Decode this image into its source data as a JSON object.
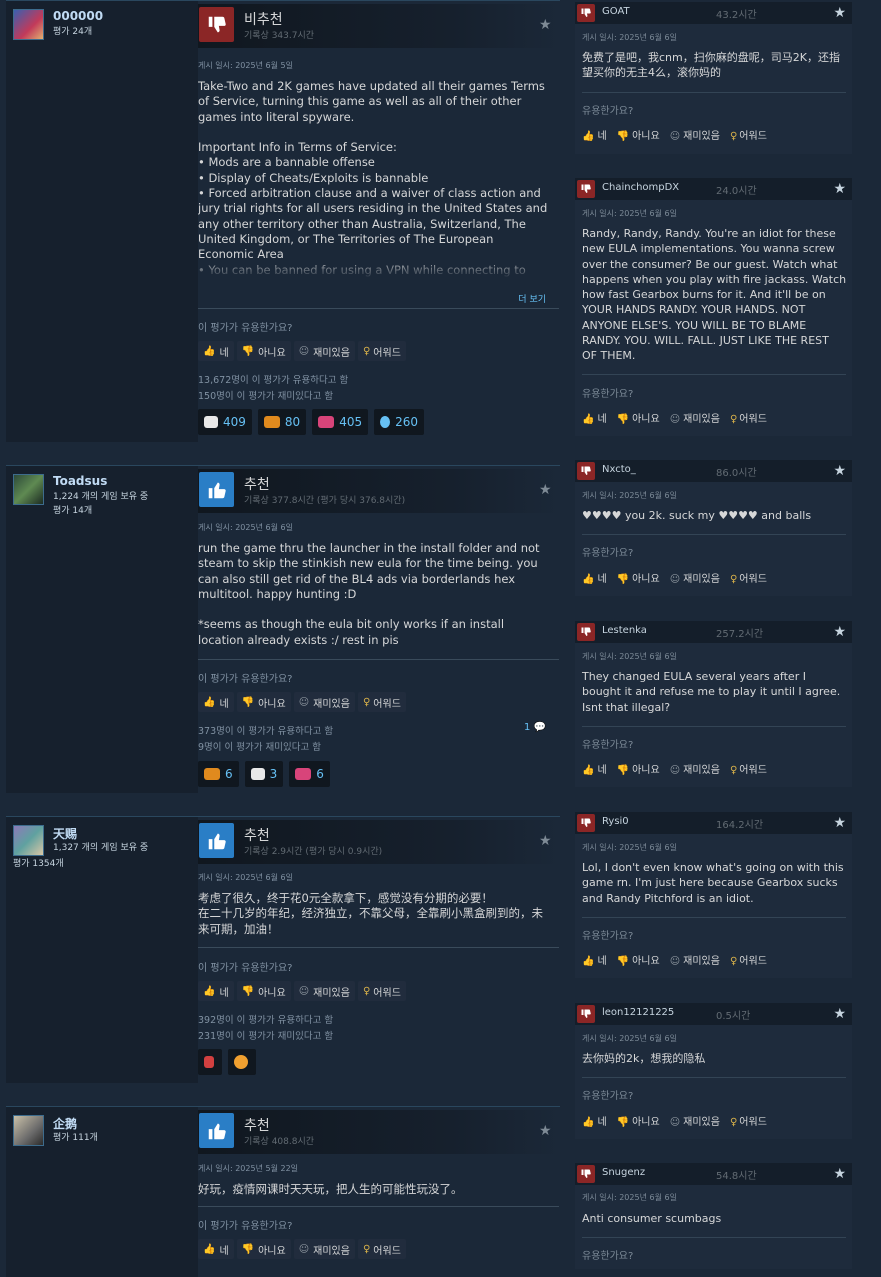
{
  "ui": {
    "helpful_q": "이 평가가 유용한가요?",
    "side_helpful_q": "유용한가요?",
    "btn_yes": "네",
    "btn_no": "아니요",
    "btn_funny": "재미있음",
    "btn_award": "어워드",
    "read_more": "더 보기"
  },
  "reviews": [
    {
      "username": "000000",
      "info": "평가 24개",
      "vote": "비추천",
      "hours": "기록상 343.7시간",
      "posted": "게시 일시: 2025년 6월 5일",
      "text": "Take-Two and 2K games have updated all their games Terms of Service, turning this game as well as all of their other games into literal spyware.\n\nImportant Info in Terms of Service:\n• Mods are a bannable offense\n• Display of Cheats/Exploits is bannable\n• Forced arbitration clause and a waiver of class action and jury trial rights for all users residing in the United States and any other territory other than Australia, Switzerland, The United Kingdom, or The Territories of The European Economic Area\n• You can be banned for using a VPN while connecting to online servers",
      "stat1": "13,672명이 이 평가가 유용하다고 함",
      "stat2": "150명이 이 평가가 재미있다고 함",
      "awards": [
        "409",
        "80",
        "405",
        "260"
      ]
    },
    {
      "username": "Toadsus",
      "info1": "1,224 개의 게임 보유 중",
      "info2": "평가 14개",
      "vote": "추천",
      "hours": "기록상 377.8시간 (평가 당시 376.8시간)",
      "posted": "게시 일시: 2025년 6월 6일",
      "text": "run the game thru the launcher in the install folder and not steam to skip the stinkish new eula for the time being. you can also still get rid of the BL4 ads via borderlands hex multitool. happy hunting :D\n\n*seems as though the eula bit only works if an install location already exists :/ rest in pis",
      "stat1": "373명이 이 평가가 유용하다고 함",
      "stat2": "9명이 이 평가가 재미있다고 함",
      "comments": "1",
      "awards": [
        "6",
        "3",
        "6"
      ]
    },
    {
      "username": "天赐",
      "info1": "1,327 개의 게임 보유 중",
      "info2": "평가 1354개",
      "vote": "추천",
      "hours": "기록상 2.9시간 (평가 당시 0.9시간)",
      "posted": "게시 일시: 2025년 6월 6일",
      "text": "考虑了很久，终于花0元全款拿下，感觉没有分期的必要！\n在二十几岁的年纪，经济独立，不靠父母，全靠刷小黑盒刷到的，未来可期，加油！",
      "stat1": "392명이 이 평가가 유용하다고 함",
      "stat2": "231명이 이 평가가 재미있다고 함"
    },
    {
      "username": "企鹅",
      "info": "평가 111개",
      "vote": "추천",
      "hours": "기록상 408.8시간",
      "posted": "게시 일시: 2025년 5월 22일",
      "text": "好玩，疫情网课时天天玩，把人生的可能性玩没了。"
    }
  ],
  "side_reviews": [
    {
      "name": "GOAT",
      "hours": "43.2시간",
      "posted": "게시 일시: 2025년 6월 6일",
      "text": "免费了是吧，我cnm，扫你麻的盘呢，司马2K，还指望买你的无主4么，滚你妈的"
    },
    {
      "name": "ChainchompDX",
      "hours": "24.0시간",
      "posted": "게시 일시: 2025년 6월 6일",
      "text": "Randy, Randy, Randy. You're an idiot for these new EULA implementations. You wanna screw over the consumer? Be our guest. Watch what happens when you play with fire jackass. Watch how fast Gearbox burns for it. And it'll be on YOUR HANDS RANDY. YOUR HANDS. NOT ANYONE ELSE'S. YOU WILL BE TO BLAME RANDY. YOU. WILL. FALL. JUST LIKE THE REST OF THEM."
    },
    {
      "name": "Nxcto_",
      "hours": "86.0시간",
      "posted": "게시 일시: 2025년 6월 6일",
      "text": "♥♥♥♥ you 2k. suck my ♥♥♥♥ and balls"
    },
    {
      "name": "Lestenka",
      "hours": "257.2시간",
      "posted": "게시 일시: 2025년 6월 6일",
      "text": "They changed EULA several years after I bought it and refuse me to play it until I agree. Isnt that illegal?"
    },
    {
      "name": "Rysi0",
      "hours": "164.2시간",
      "posted": "게시 일시: 2025년 6월 6일",
      "text": "Lol, I don't even know what's going on with this game rn. I'm just here because Gearbox sucks and Randy Pitchford is an idiot."
    },
    {
      "name": "leon12121225",
      "hours": "0.5시간",
      "posted": "게시 일시: 2025년 6월 6일",
      "text": "去你妈的2k，想我的隐私"
    },
    {
      "name": "Snugenz",
      "hours": "54.8시간",
      "posted": "게시 일시: 2025년 6월 6일",
      "text": "Anti consumer scumbags"
    }
  ]
}
